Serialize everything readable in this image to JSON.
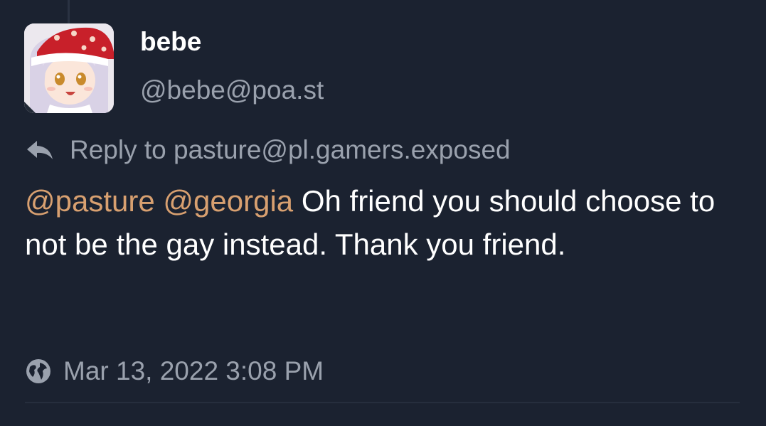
{
  "status": {
    "author": {
      "display_name": "bebe",
      "handle": "@bebe@poa.st",
      "avatar_icon": "anime-girl-santa-hat-avatar"
    },
    "reply_to": {
      "icon": "reply-arrow-icon",
      "label": "Reply to pasture@pl.gamers.exposed"
    },
    "content": {
      "mentions": [
        "@pasture",
        "@georgia"
      ],
      "text": "Oh friend you should choose to not be the gay instead. Thank you friend."
    },
    "visibility_icon": "globe-icon",
    "timestamp": "Mar 13, 2022 3:08 PM"
  },
  "colors": {
    "background": "#1b2230",
    "mention": "#d8a070",
    "muted_text": "#9aa1ad",
    "body_text": "#ffffff"
  }
}
